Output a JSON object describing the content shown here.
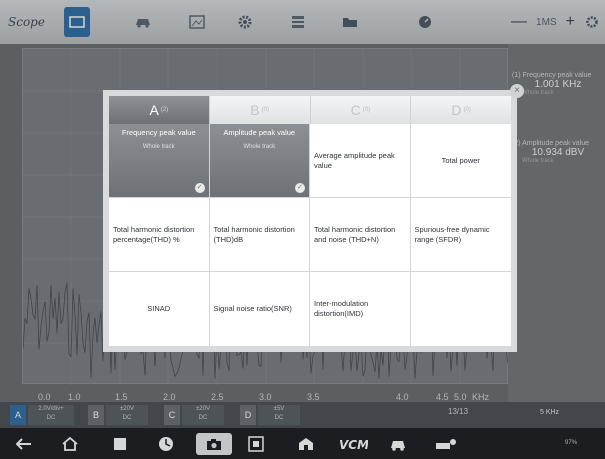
{
  "app": {
    "title": "Scope"
  },
  "toolbar": {
    "icons": [
      "monitor-icon",
      "car-icon",
      "image-icon",
      "gear-icon",
      "list-icon",
      "folder-icon",
      "gauge-icon",
      "settings-icon"
    ],
    "zoom": {
      "minus": "—",
      "value": "1MS",
      "plus": "+"
    }
  },
  "plot": {
    "x_labels": [
      "0.0",
      "1.0",
      "1.5",
      "2.0",
      "2.5",
      "3.0",
      "3.5",
      "4.0",
      "4.5",
      "5.0"
    ],
    "x_unit": "KHz"
  },
  "measurements": [
    {
      "title": "(1) Frequency peak value",
      "value": "1.001 KHz",
      "sub": "Whole track"
    },
    {
      "title": "(2) Amplitude peak value",
      "value": "10.934 dBV",
      "sub": "Whole track"
    }
  ],
  "channels": [
    {
      "letter": "A",
      "color": "#2f6da6",
      "scale": "2.0V/div+",
      "coupling": "DC"
    },
    {
      "letter": "B",
      "color": "#8a8f95",
      "scale": "±20V",
      "coupling": "DC"
    },
    {
      "letter": "C",
      "color": "#8a8f95",
      "scale": "±20V",
      "coupling": "DC"
    },
    {
      "letter": "D",
      "color": "#8a8f95",
      "scale": "±5V",
      "coupling": "DC"
    }
  ],
  "pager": "13/13",
  "freq_label": "5 KHz",
  "status": "97%",
  "modal": {
    "tabs": [
      {
        "label": "A",
        "sub": "(2)"
      },
      {
        "label": "B",
        "sub": "(0)"
      },
      {
        "label": "C",
        "sub": "(0)"
      },
      {
        "label": "D",
        "sub": "(0)"
      }
    ],
    "cells": [
      {
        "label": "Frequency peak value",
        "sub": "Whole track"
      },
      {
        "label": "Amplitude peak value",
        "sub": "Whole track"
      },
      {
        "label": "Average amplitude peak value"
      },
      {
        "label": "Total power"
      },
      {
        "label": "Total harmonic distortion percentage(THD) %"
      },
      {
        "label": "Total harmonic distortion (THD)dB"
      },
      {
        "label": "Total harmonic distortion and noise (THD+N)"
      },
      {
        "label": "Spurious-free dynamic range (SFDR)"
      },
      {
        "label": "SINAD"
      },
      {
        "label": "Signal noise ratio(SNR)"
      },
      {
        "label": "Inter-modulation distortion(IMD)"
      },
      {
        "label": ""
      }
    ],
    "close": "×"
  }
}
